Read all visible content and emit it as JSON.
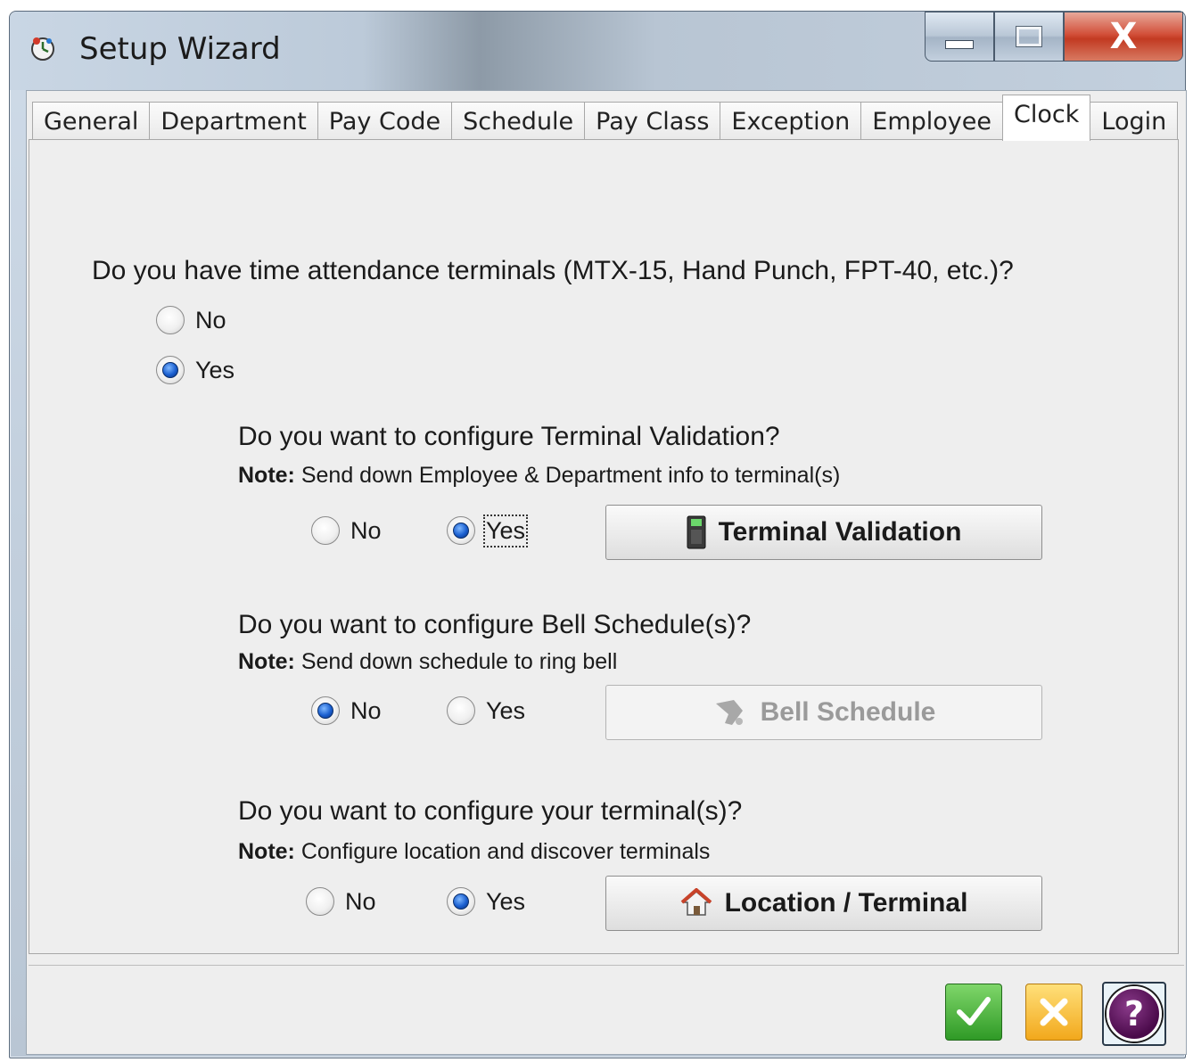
{
  "window": {
    "title": "Setup Wizard",
    "close_glyph": "X"
  },
  "tabs": [
    {
      "label": "General"
    },
    {
      "label": "Department"
    },
    {
      "label": "Pay Code"
    },
    {
      "label": "Schedule"
    },
    {
      "label": "Pay Class"
    },
    {
      "label": "Exception"
    },
    {
      "label": "Employee"
    },
    {
      "label": "Clock",
      "active": true
    },
    {
      "label": "Login"
    }
  ],
  "terminals_question": {
    "text": "Do you have time attendance terminals (MTX-15, Hand Punch, FPT-40, etc.)?",
    "options": {
      "no": "No",
      "yes": "Yes"
    },
    "selected": "Yes"
  },
  "validation": {
    "question": "Do you want to configure Terminal Validation?",
    "note_label": "Note:",
    "note_text": " Send down Employee & Department info to terminal(s)",
    "no": "No",
    "yes": "Yes",
    "selected": "Yes",
    "button": "Terminal Validation",
    "button_icon": "terminal-device-icon"
  },
  "bell": {
    "question": "Do you want to configure Bell Schedule(s)?",
    "note_label": "Note:",
    "note_text": " Send down schedule to ring bell",
    "no": "No",
    "yes": "Yes",
    "selected": "No",
    "button": "Bell Schedule",
    "button_icon": "bell-icon",
    "button_enabled": false
  },
  "terminal_config": {
    "question": "Do you want to configure your terminal(s)?",
    "note_label": "Note:",
    "note_text": " Configure location and discover terminals",
    "no": "No",
    "yes": "Yes",
    "selected": "Yes",
    "button": "Location / Terminal",
    "button_icon": "location-house-icon"
  },
  "footer": {
    "ok_icon": "checkmark-icon",
    "cancel_icon": "x-icon",
    "help_glyph": "?"
  }
}
